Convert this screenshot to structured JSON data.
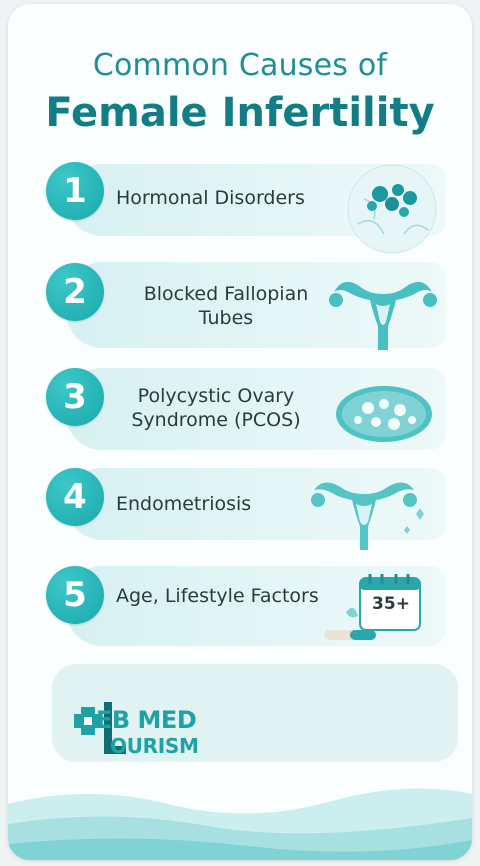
{
  "title": {
    "line1": "Common Causes of",
    "line2": "Female Infertility"
  },
  "items": [
    {
      "number": "1",
      "label": "Hormonal Disorders",
      "icon": "hormone-cells-icon"
    },
    {
      "number": "2",
      "label": "Blocked Fallopian Tubes",
      "icon": "uterus-icon"
    },
    {
      "number": "3",
      "label": "Polycystic Ovary Syndrome (PCOS)",
      "icon": "ovary-icon"
    },
    {
      "number": "4",
      "label": "Endometriosis",
      "icon": "uterus-endometriosis-icon"
    },
    {
      "number": "5",
      "label": "Age, Lifestyle Factors",
      "icon": "calendar-icon"
    }
  ],
  "calendar_badge": "35+",
  "logo": {
    "eb_med": "EB MED",
    "tourism": "OURISM"
  },
  "colors": {
    "accent": "#1aa9ad",
    "title": "#137d86",
    "item_bg": "#d7f0f1"
  }
}
